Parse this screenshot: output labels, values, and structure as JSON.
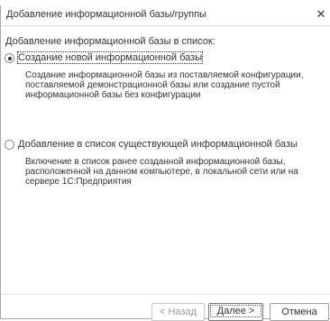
{
  "window": {
    "title": "Добавление информационной базы/группы",
    "close_glyph": "✕"
  },
  "heading": "Добавление информационной базы в список:",
  "options": [
    {
      "label": "Создание новой информационной базы",
      "description": "Создание информационной базы из поставляемой конфигурации, поставляемой демонстрационной базы или создание пустой информационной базы без конфигурации",
      "selected": true
    },
    {
      "label": "Добавление в список существующей информационной базы",
      "description": "Включение в список ранее созданной информационной базы, расположенной на данном компьютере, в локальной сети или на сервере 1С:Предприятия",
      "selected": false
    }
  ],
  "buttons": {
    "back": "< Назад",
    "next": "Далее >",
    "cancel": "Отмена"
  }
}
